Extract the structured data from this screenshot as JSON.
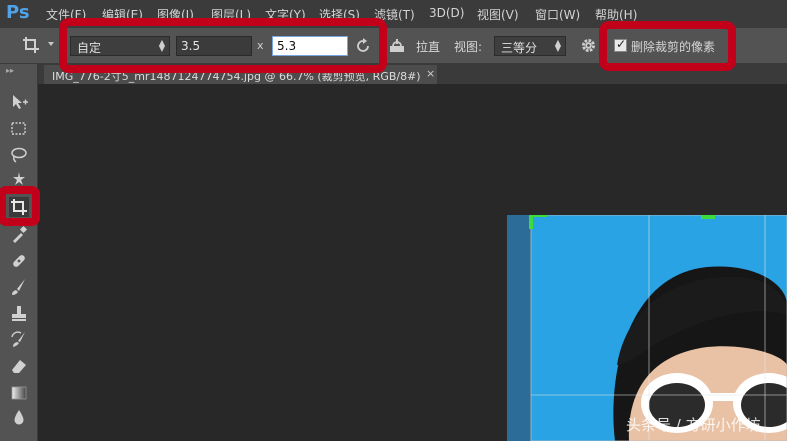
{
  "app": {
    "logo": "Ps"
  },
  "menu": [
    {
      "label": "文件(F)"
    },
    {
      "label": "编辑(E)"
    },
    {
      "label": "图像(I)"
    },
    {
      "label": "图层(L)"
    },
    {
      "label": "文字(Y)"
    },
    {
      "label": "选择(S)"
    },
    {
      "label": "滤镜(T)"
    },
    {
      "label": "3D(D)"
    },
    {
      "label": "视图(V)"
    },
    {
      "label": "窗口(W)"
    },
    {
      "label": "帮助(H)"
    }
  ],
  "options": {
    "ratio_preset": "自定",
    "width_value": "3.5",
    "x_label": "x",
    "height_value": "5.3",
    "straighten_label": "拉直",
    "view_label": "视图:",
    "view_value": "三等分",
    "delete_pixels_label": "删除裁剪的像素",
    "delete_pixels_checked": true
  },
  "document": {
    "tab_title": "IMG_776-2寸5_mr1487124774754.jpg @ 66.7% (裁剪预览, RGB/8#)",
    "close_glyph": "×"
  },
  "icons": {
    "crop": "crop-icon",
    "rotate": "rotate-icon",
    "straighten": "straighten-icon",
    "gear": "gear-icon"
  },
  "colors": {
    "annotation": "#c2001a",
    "photo_background": "#2aa6e6",
    "crop_handle": "#3ddc3d",
    "ps_blue": "#4fa3e6"
  },
  "watermark": "头条号 / 方研小作坊"
}
